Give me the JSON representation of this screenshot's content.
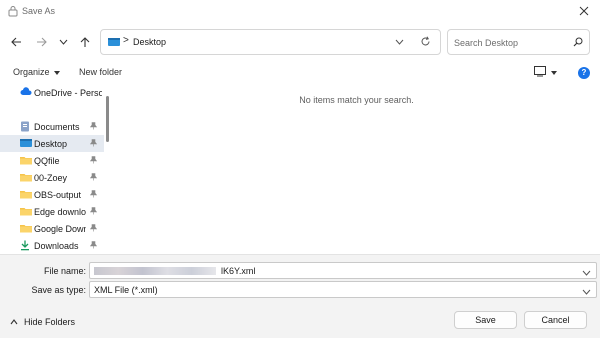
{
  "window": {
    "title": "Save As",
    "close_icon": "close-icon"
  },
  "nav": {
    "back_icon": "arrow-left-icon",
    "forward_icon": "arrow-right-icon",
    "recent_icon": "chevron-down-icon",
    "up_icon": "arrow-up-icon",
    "address": {
      "icon": "desktop-folder-icon",
      "separator": ">",
      "crumb": "Desktop"
    },
    "refresh_icon": "refresh-icon",
    "search": {
      "placeholder": "Search Desktop",
      "icon": "search-icon"
    }
  },
  "toolbar": {
    "organize_label": "Organize",
    "new_folder_label": "New folder",
    "view_icon": "view-icon",
    "help_label": "?"
  },
  "sidebar": {
    "items": [
      {
        "label": "OneDrive - Persor",
        "icon": "cloud-icon",
        "pinned": false,
        "selected": false
      },
      {
        "label": "Documents",
        "icon": "documents-icon",
        "pinned": true,
        "selected": false
      },
      {
        "label": "Desktop",
        "icon": "desktop-icon",
        "pinned": true,
        "selected": true
      },
      {
        "label": "QQfile",
        "icon": "folder-icon",
        "pinned": true,
        "selected": false
      },
      {
        "label": "00-Zoey",
        "icon": "folder-icon",
        "pinned": true,
        "selected": false
      },
      {
        "label": "OBS-output",
        "icon": "folder-icon",
        "pinned": true,
        "selected": false
      },
      {
        "label": "Edge downloa",
        "icon": "folder-icon",
        "pinned": true,
        "selected": false
      },
      {
        "label": "Google Downl",
        "icon": "folder-icon",
        "pinned": true,
        "selected": false
      },
      {
        "label": "Downloads",
        "icon": "download-icon",
        "pinned": true,
        "selected": false
      }
    ]
  },
  "main": {
    "empty_message": "No items match your search."
  },
  "form": {
    "file_name_label": "File name:",
    "file_name_value": "lK6Y.xml",
    "save_as_type_label": "Save as type:",
    "save_as_type_value": "XML File (*.xml)"
  },
  "footer": {
    "hide_folders_label": "Hide Folders",
    "save_label": "Save",
    "cancel_label": "Cancel"
  },
  "colors": {
    "accent": "#1a73e8",
    "folder": "#f6c34a",
    "selected_bg": "#e5eaf1"
  }
}
